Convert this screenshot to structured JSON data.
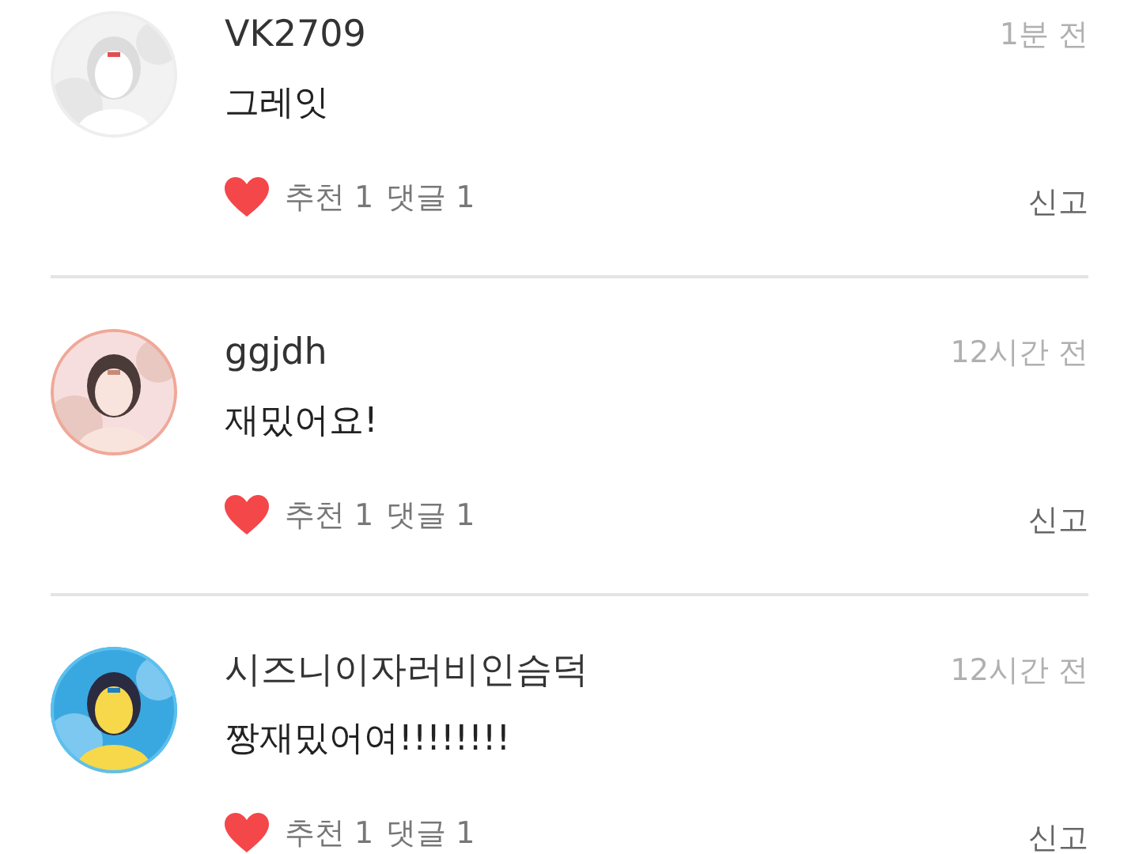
{
  "comments": [
    {
      "author": "VK2709",
      "time": "1분 전",
      "text": "그레잇",
      "likes": "추천 1",
      "replies": "댓글 1",
      "report": "신고"
    },
    {
      "author": "ggjdh",
      "time": "12시간 전",
      "text": "재밌어요!",
      "likes": "추천 1",
      "replies": "댓글 1",
      "report": "신고"
    },
    {
      "author": "시즈니이자러비인슴덕",
      "time": "12시간 전",
      "text": "짱재밌어여!!!!!!!!",
      "likes": "추천 1",
      "replies": "댓글 1",
      "report": "신고"
    }
  ]
}
